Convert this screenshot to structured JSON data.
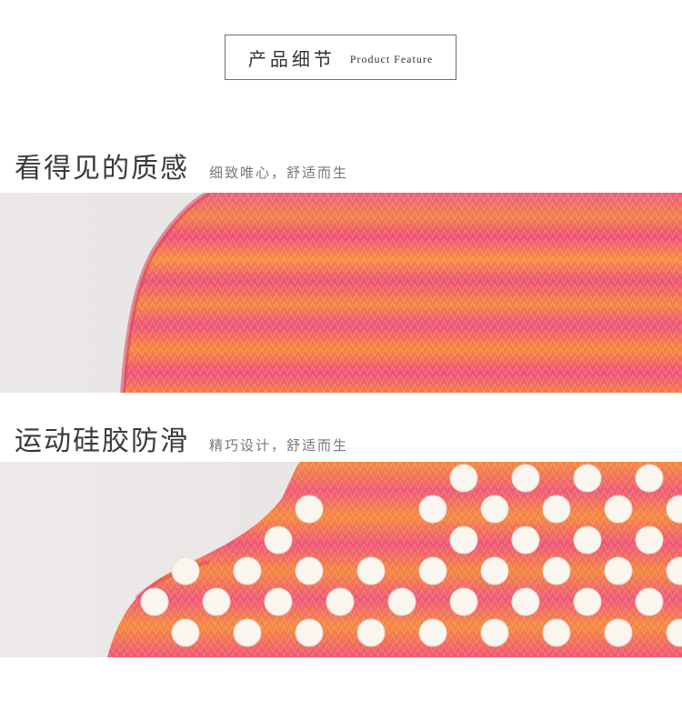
{
  "header": {
    "title_cn": "产品细节",
    "title_en": "Product Feature"
  },
  "sections": [
    {
      "title": "看得见的质感",
      "subtitle": "细致唯心，舒适而生"
    },
    {
      "title": "运动硅胶防滑",
      "subtitle": "精巧设计，舒适而生"
    }
  ],
  "colors": {
    "sock_pink": "#f0527a",
    "sock_orange": "#f58a3c",
    "dot_white": "#fbf5ef",
    "background": "#efeae8"
  },
  "images": [
    "knit-texture-photo",
    "silicone-dots-photo"
  ]
}
